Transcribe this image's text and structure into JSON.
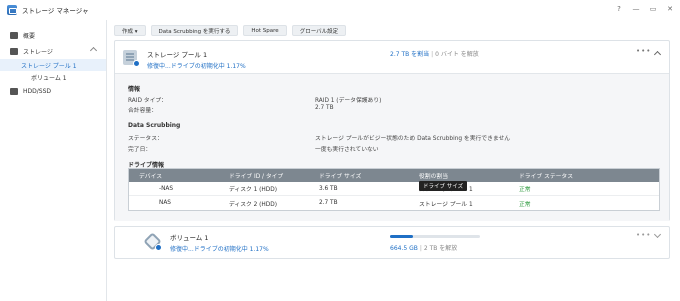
{
  "window": {
    "title": "ストレージ マネージャ",
    "controls": [
      "?",
      "—",
      "▭",
      "✕"
    ]
  },
  "sidebar": {
    "items": [
      {
        "label": "概要"
      },
      {
        "label": "ストレージ"
      },
      {
        "label": "ストレージ プール 1"
      },
      {
        "label": "ボリューム 1"
      },
      {
        "label": "HDD/SSD"
      }
    ]
  },
  "toolbar": {
    "create": "作成 ▾",
    "scrubbing": "Data Scrubbing を実行する",
    "hotspare": "Hot Spare",
    "global": "グローバル設定"
  },
  "pool": {
    "name": "ストレージ プール 1",
    "status": "修復中...ドライブの初期化中 1.17%",
    "used": "2.7 TB を割当",
    "free": "0 バイト を解放",
    "more": "•••",
    "info": {
      "heading": "情報",
      "raid_label": "RAID タイプ：",
      "raid_value": "RAID 1 (データ保護あり)",
      "capacity_label": "合計容量：",
      "capacity_value": "2.7 TB"
    },
    "scrubbing": {
      "heading": "Data Scrubbing",
      "status_label": "ステータス：",
      "status_value": "ストレージ プールがビジー状態のため Data Scrubbing を実行できません",
      "done_label": "完了日：",
      "done_value": "一度も実行されていない"
    },
    "drives": {
      "heading": "ドライブ情報",
      "columns": [
        "デバイス",
        "ドライブ ID / タイプ",
        "ドライブ サイズ",
        "役割の割当",
        "ドライブ ステータス"
      ],
      "rows": [
        [
          "-NAS",
          "ディスク 1 (HDD)",
          "3.6 TB",
          "ストレージ プール 1",
          "正常"
        ],
        [
          "NAS",
          "ディスク 2 (HDD)",
          "2.7 TB",
          "ストレージ プール 1",
          "正常"
        ]
      ]
    },
    "tooltip": "ドライブ サイズ"
  },
  "volume": {
    "name": "ボリューム 1",
    "status": "修復中...ドライブの初期化中 1.17%",
    "used": "664.5 GB",
    "free": "2 TB を解放",
    "usage_fraction": 0.25,
    "more": "•••"
  },
  "colors": {
    "accent": "#1f6fc5",
    "ok": "#2d9a3e",
    "table_header": "#7d8790"
  }
}
